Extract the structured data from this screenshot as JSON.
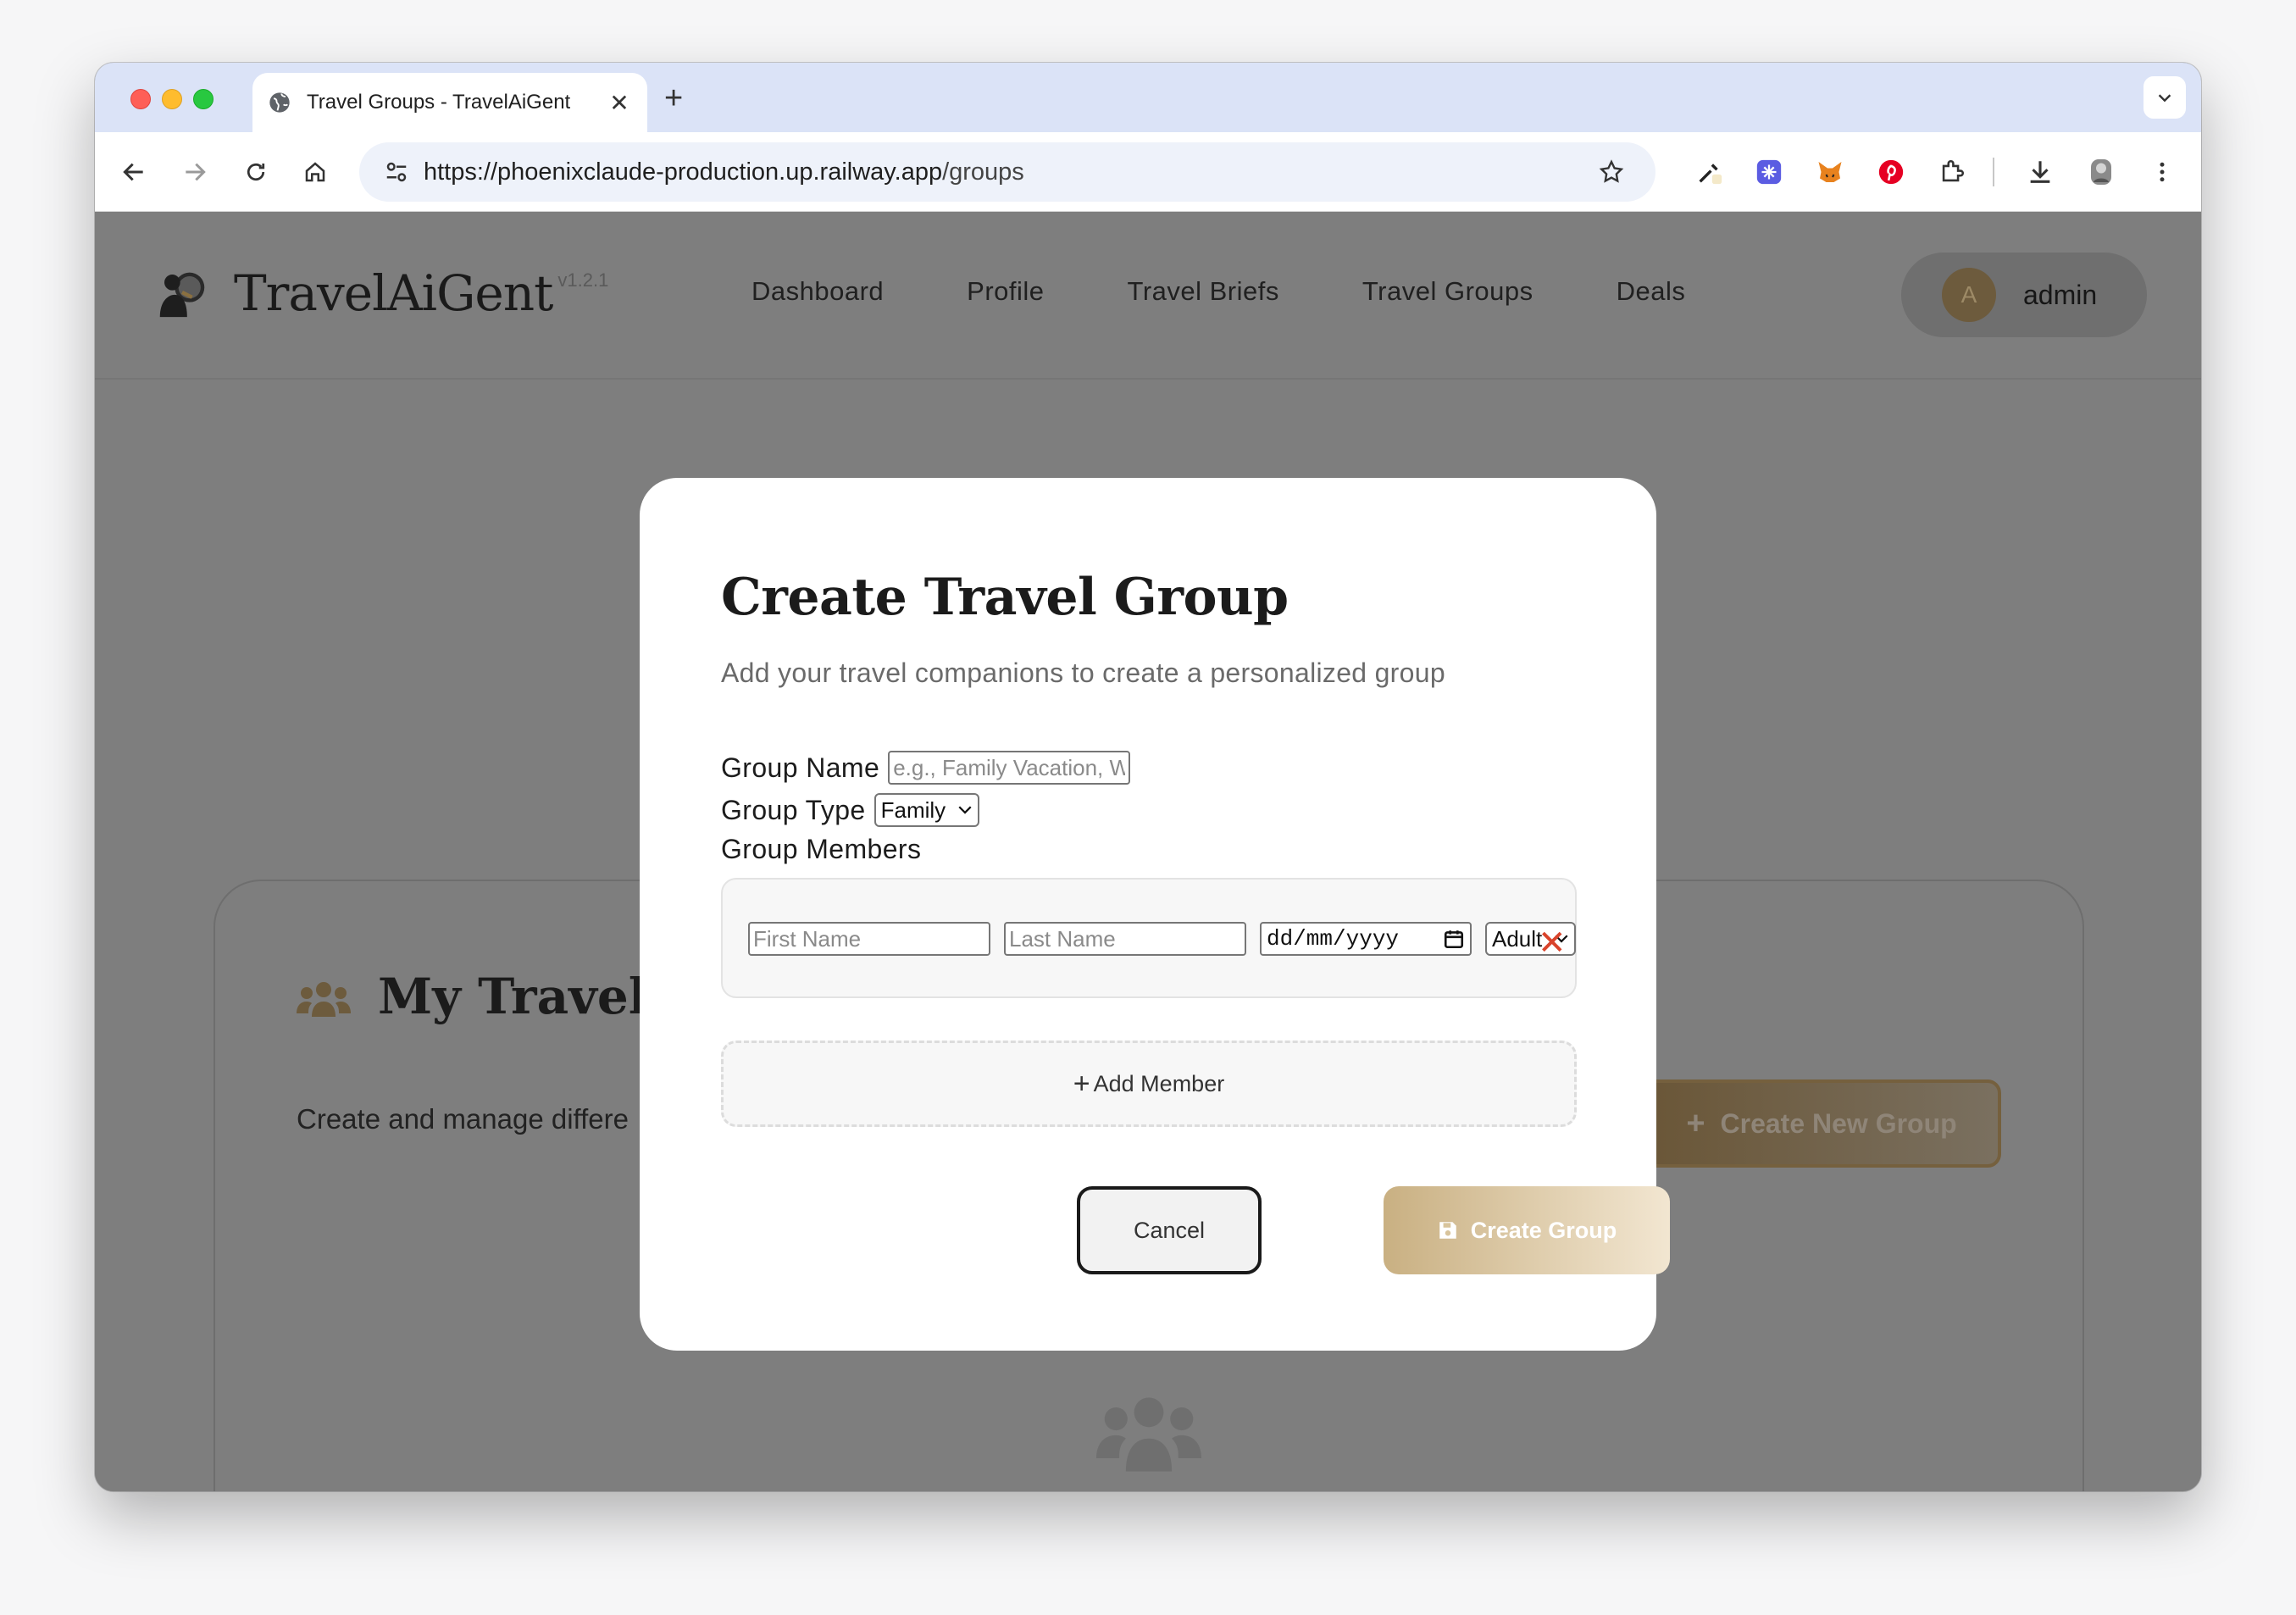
{
  "browser": {
    "tab_title": "Travel Groups - TravelAiGent",
    "tab_close": "✕",
    "new_tab": "+",
    "url_host": "https://phoenixclaude-production.up.railway.app",
    "url_path": "/groups"
  },
  "header": {
    "brand_name": "TravelAiGent",
    "version": "v1.2.1",
    "nav": [
      "Dashboard",
      "Profile",
      "Travel Briefs",
      "Travel Groups",
      "Deals"
    ],
    "user_initial": "A",
    "user_name": "admin"
  },
  "background": {
    "card_title": "My Travel Gr",
    "card_desc": "Create and manage differe",
    "create_new_group": "Create New Group"
  },
  "modal": {
    "title": "Create Travel Group",
    "subtitle": "Add your travel companions to create a personalized group",
    "group_name_label": "Group Name",
    "group_name_placeholder": "e.g., Family Vacation, W",
    "group_type_label": "Group Type",
    "group_type_value": "Family",
    "group_members_label": "Group Members",
    "member": {
      "first_name_placeholder": "First Name",
      "last_name_placeholder": "Last Name",
      "date_placeholder": "dd/mm/yyyy",
      "age_type": "Adult"
    },
    "remove_symbol": "✕",
    "add_member_label": "Add Member",
    "cancel_label": "Cancel",
    "create_label": "Create Group"
  },
  "colors": {
    "accent_gold": "#c9b082",
    "remove_red": "#d9432b",
    "overlay": "#7e7e7e"
  }
}
